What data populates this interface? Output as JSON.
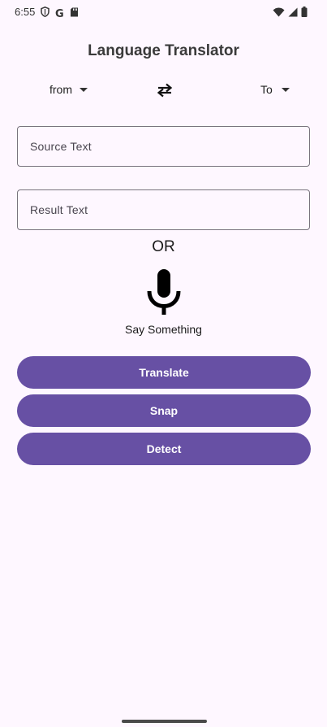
{
  "status_bar": {
    "time": "6:55",
    "g_label": "G",
    "icons_left": [
      "shield-icon",
      "google-icon",
      "sd-card-icon"
    ],
    "icons_right": [
      "wifi-icon",
      "signal-icon",
      "battery-icon"
    ]
  },
  "app": {
    "title": "Language Translator"
  },
  "language_bar": {
    "from_label": "from",
    "to_label": "To",
    "swap_icon": "swap-arrows-icon"
  },
  "inputs": {
    "source_label": "Source Text",
    "result_label": "Result Text"
  },
  "voice": {
    "or_text": "OR",
    "prompt": "Say Something",
    "mic_icon": "microphone-icon"
  },
  "buttons": {
    "translate": "Translate",
    "snap": "Snap",
    "detect": "Detect"
  },
  "colors": {
    "background": "#FEF7FF",
    "accent": "#6750A4",
    "outline": "#79747E"
  }
}
